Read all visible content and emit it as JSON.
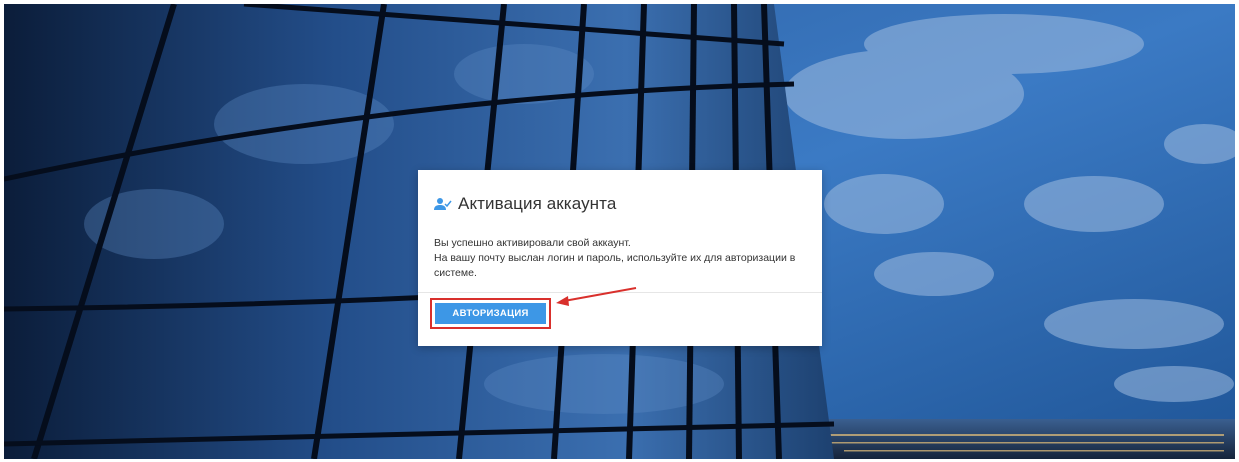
{
  "dialog": {
    "title": "Активация аккаунта",
    "icon": "user-check-icon",
    "message_lines": [
      "Вы успешно активировали свой аккаунт.",
      "На вашу почту выслан логин и пароль, используйте их для авторизации в",
      "системе."
    ],
    "button_label": "АВТОРИЗАЦИЯ"
  },
  "colors": {
    "button": "#3d97e6",
    "highlight": "#d9302c",
    "icon": "#3d97e6"
  }
}
